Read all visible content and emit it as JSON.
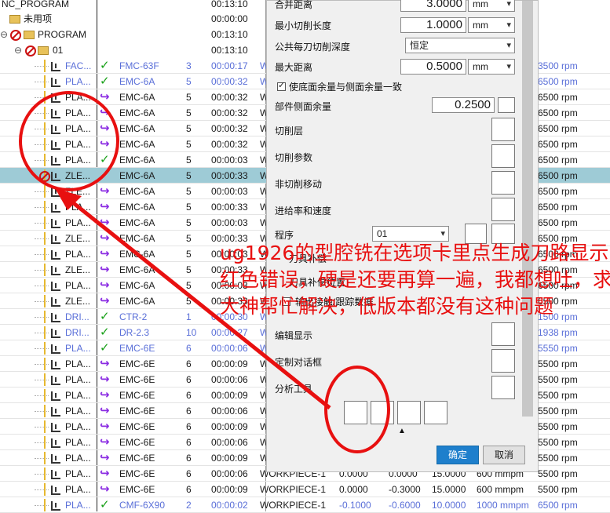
{
  "tree": {
    "root": "NC_PROGRAM",
    "root_time": "00:13:10",
    "unused": "未用项",
    "unused_time": "00:00:00",
    "program": "PROGRAM",
    "program_time": "00:13:10",
    "group01": "01",
    "group01_time": "00:13:10",
    "top_value": "3.0000",
    "top_unit": "mm"
  },
  "operations": [
    {
      "name": "FAC...",
      "check": "✓",
      "tool": "FMC-63F",
      "num": "3",
      "time": "00:00:17",
      "geo": "W",
      "rpm": "3500 rpm",
      "blue": true
    },
    {
      "name": "PLA...",
      "check": "✓",
      "tool": "EMC-6A",
      "num": "5",
      "time": "00:00:32",
      "geo": "W",
      "rpm": "6500 rpm",
      "blue": true
    },
    {
      "name": "PLA...",
      "check": "↪",
      "tool": "EMC-6A",
      "num": "5",
      "time": "00:00:32",
      "geo": "W",
      "rpm": "6500 rpm"
    },
    {
      "name": "PLA...",
      "check": "↪",
      "tool": "EMC-6A",
      "num": "5",
      "time": "00:00:32",
      "geo": "W",
      "rpm": "6500 rpm"
    },
    {
      "name": "PLA...",
      "check": "↪",
      "tool": "EMC-6A",
      "num": "5",
      "time": "00:00:32",
      "geo": "W",
      "rpm": "6500 rpm"
    },
    {
      "name": "PLA...",
      "check": "↪",
      "tool": "EMC-6A",
      "num": "5",
      "time": "00:00:32",
      "geo": "W",
      "rpm": "6500 rpm"
    },
    {
      "name": "PLA...",
      "check": "✓",
      "tool": "EMC-6A",
      "num": "5",
      "time": "00:00:03",
      "geo": "W",
      "rpm": "6500 rpm"
    },
    {
      "name": "ZLE...",
      "check": "",
      "tool": "EMC-6A",
      "num": "5",
      "time": "00:00:33",
      "geo": "W",
      "rpm": "6500 rpm",
      "selected": true
    },
    {
      "name": "ZLE...",
      "check": "↪",
      "tool": "EMC-6A",
      "num": "5",
      "time": "00:00:03",
      "geo": "W",
      "rpm": "6500 rpm"
    },
    {
      "name": "PLA...",
      "check": "↪",
      "tool": "EMC-6A",
      "num": "5",
      "time": "00:00:33",
      "geo": "W",
      "rpm": "6500 rpm"
    },
    {
      "name": "PLA...",
      "check": "↪",
      "tool": "EMC-6A",
      "num": "5",
      "time": "00:00:03",
      "geo": "W",
      "rpm": "6500 rpm"
    },
    {
      "name": "ZLE...",
      "check": "↪",
      "tool": "EMC-6A",
      "num": "5",
      "time": "00:00:33",
      "geo": "W",
      "rpm": "6500 rpm"
    },
    {
      "name": "PLA...",
      "check": "↪",
      "tool": "EMC-6A",
      "num": "5",
      "time": "00:00:03",
      "geo": "W",
      "rpm": "6500 rpm"
    },
    {
      "name": "ZLE...",
      "check": "↪",
      "tool": "EMC-6A",
      "num": "5",
      "time": "00:00:33",
      "geo": "W",
      "rpm": "6500 rpm"
    },
    {
      "name": "PLA...",
      "check": "↪",
      "tool": "EMC-6A",
      "num": "5",
      "time": "00:00:03",
      "geo": "W",
      "rpm": "6500 rpm"
    },
    {
      "name": "ZLE...",
      "check": "↪",
      "tool": "EMC-6A",
      "num": "5",
      "time": "00:00:33",
      "geo": "W",
      "rpm": "6500 rpm"
    },
    {
      "name": "DRI...",
      "check": "✓",
      "tool": "CTR-2",
      "num": "1",
      "time": "00:00:30",
      "geo": "W",
      "rpm": "1500 rpm",
      "blue": true
    },
    {
      "name": "DRI...",
      "check": "✓",
      "tool": "DR-2.3",
      "num": "10",
      "time": "00:00:27",
      "geo": "W",
      "rpm": "1938 rpm",
      "blue": true
    },
    {
      "name": "PLA...",
      "check": "✓",
      "tool": "EMC-6E",
      "num": "6",
      "time": "00:00:06",
      "geo": "W",
      "rpm": "5550 rpm",
      "blue": true
    },
    {
      "name": "PLA...",
      "check": "↪",
      "tool": "EMC-6E",
      "num": "6",
      "time": "00:00:09",
      "geo": "W",
      "rpm": "5500 rpm"
    },
    {
      "name": "PLA...",
      "check": "↪",
      "tool": "EMC-6E",
      "num": "6",
      "time": "00:00:06",
      "geo": "W",
      "rpm": "5500 rpm"
    },
    {
      "name": "PLA...",
      "check": "↪",
      "tool": "EMC-6E",
      "num": "6",
      "time": "00:00:09",
      "geo": "W",
      "rpm": "5500 rpm"
    },
    {
      "name": "PLA...",
      "check": "↪",
      "tool": "EMC-6E",
      "num": "6",
      "time": "00:00:06",
      "geo": "W",
      "rpm": "5500 rpm"
    },
    {
      "name": "PLA...",
      "check": "↪",
      "tool": "EMC-6E",
      "num": "6",
      "time": "00:00:09",
      "geo": "W",
      "rpm": "5500 rpm"
    },
    {
      "name": "PLA...",
      "check": "↪",
      "tool": "EMC-6E",
      "num": "6",
      "time": "00:00:06",
      "geo": "W",
      "rpm": "5500 rpm"
    },
    {
      "name": "PLA...",
      "check": "↪",
      "tool": "EMC-6E",
      "num": "6",
      "time": "00:00:09",
      "geo": "W",
      "rpm": "5500 rpm"
    },
    {
      "name": "PLA...",
      "check": "↪",
      "tool": "EMC-6E",
      "num": "6",
      "time": "00:00:06",
      "geo": "WORKPIECE-1",
      "extra": [
        "0.0000",
        "0.0000",
        "15.0000",
        "600 mmpm"
      ],
      "rpm": "5500 rpm"
    },
    {
      "name": "PLA...",
      "check": "↪",
      "tool": "EMC-6E",
      "num": "6",
      "time": "00:00:09",
      "geo": "WORKPIECE-1",
      "extra": [
        "0.0000",
        "-0.3000",
        "15.0000",
        "600 mmpm"
      ],
      "rpm": "5500 rpm"
    },
    {
      "name": "PLA...",
      "check": "✓",
      "tool": "CMF-6X90",
      "num": "2",
      "time": "00:00:02",
      "geo": "WORKPIECE-1",
      "extra": [
        "-0.1000",
        "-0.6000",
        "10.0000",
        "1000 mmpm"
      ],
      "rpm": "6500 rpm",
      "blue": true
    }
  ],
  "dialog": {
    "top_label": "合并距离",
    "min_cut_label": "最小切削长度",
    "min_cut_value": "1.0000",
    "min_cut_unit": "mm",
    "common_depth_label": "公共每刀切削深度",
    "common_depth_value": "恒定",
    "max_dist_label": "最大距离",
    "max_dist_value": "0.5000",
    "max_dist_unit": "mm",
    "same_stock_label": "使底面余量与侧面余量一致",
    "part_side_stock_label": "部件侧面余量",
    "part_side_stock_value": "0.2500",
    "cut_levels": "切削层",
    "cut_params": "切削参数",
    "non_cut_moves": "非切削移动",
    "feeds_speeds": "进给率和速度",
    "program_label": "程序",
    "program_value": "01",
    "tool_label": "刀具补偿",
    "tool_position_label": "刀具补偿位置",
    "output_contact_label": "输出接触/跟踪数据",
    "edit_display": "编辑显示",
    "custom_dialog": "定制对话框",
    "analysis_tools": "分析工具",
    "ok": "确定",
    "cancel": "取消"
  },
  "annotation": {
    "text": "ug1926的型腔铣在选项卡里点生成刀路显示红色错误，硬是还要再算一遍，我都想吐，求大神帮忙解决，低版本都没有这种问题"
  }
}
